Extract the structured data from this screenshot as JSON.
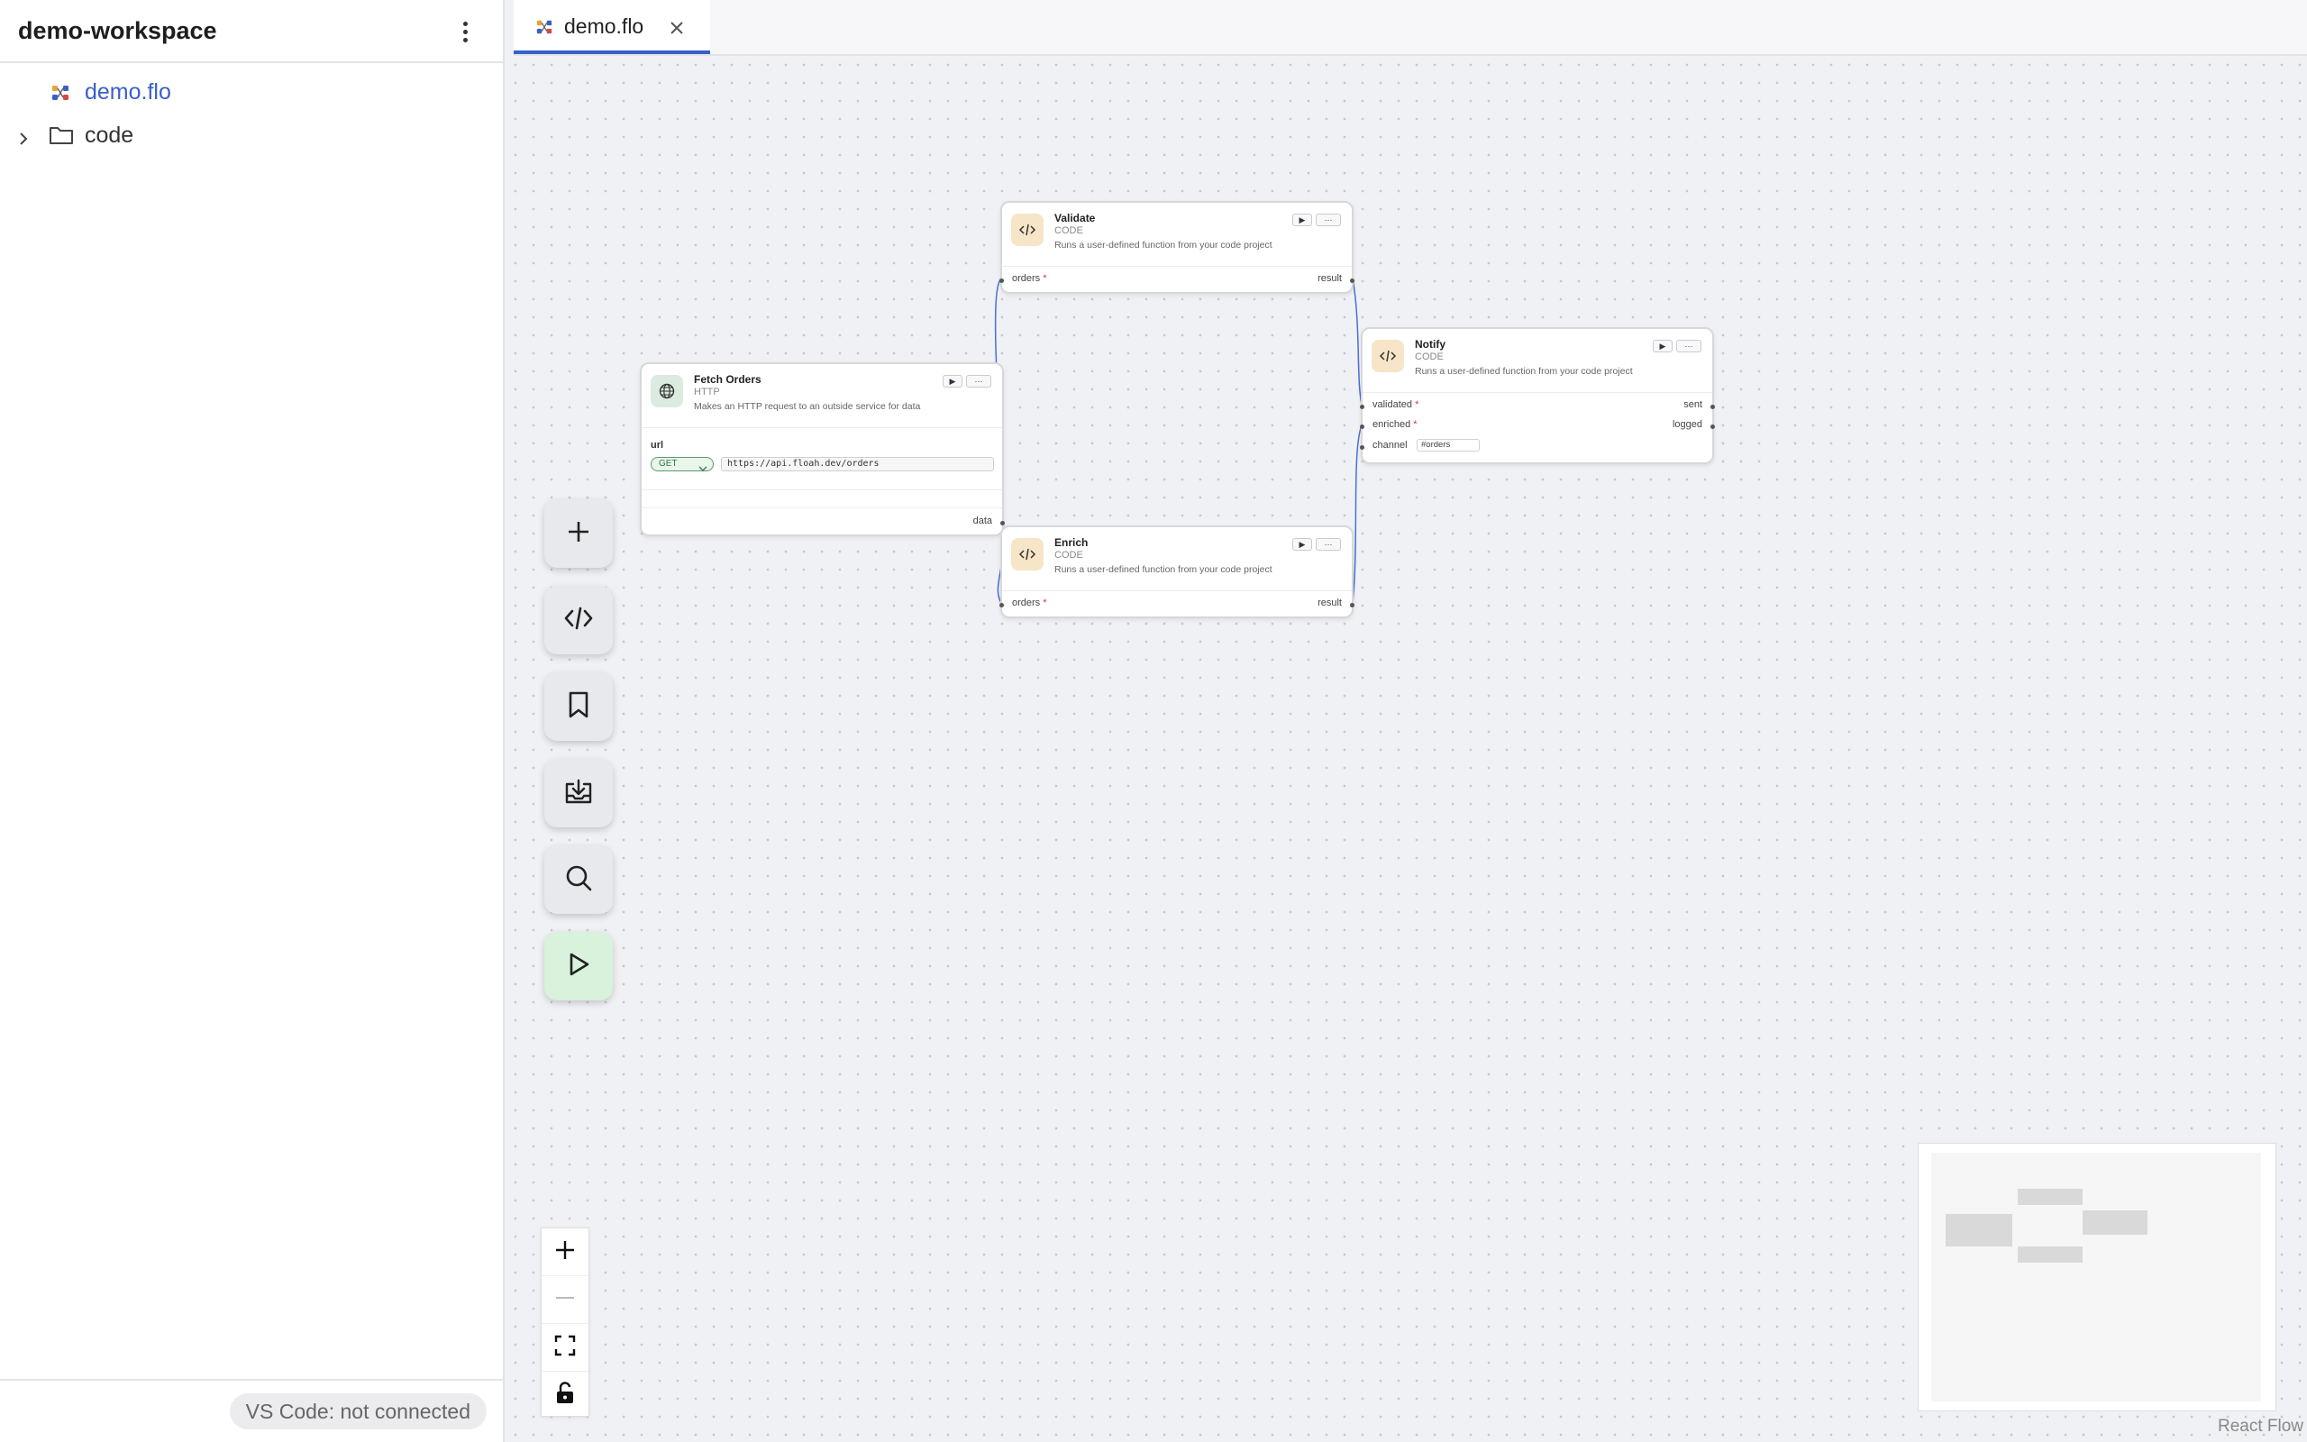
{
  "sidebar": {
    "title": "demo-workspace",
    "items": [
      {
        "label": "demo.flo",
        "icon": "flow-icon",
        "active": true
      },
      {
        "label": "code",
        "icon": "folder-icon",
        "expandable": true
      }
    ],
    "status": "VS Code: not connected"
  },
  "tabs": [
    {
      "label": "demo.flo",
      "active": true
    }
  ],
  "nodes": {
    "fetch_orders": {
      "title": "Fetch Orders",
      "type": "HTTP",
      "description": "Makes an HTTP request to an outside service for data",
      "url_label": "url",
      "method": "GET",
      "url": "https://api.floah.dev/orders",
      "output": "data"
    },
    "validate": {
      "title": "Validate",
      "type": "CODE",
      "description": "Runs a user-defined function from your code project",
      "input": "orders",
      "output": "result"
    },
    "enrich": {
      "title": "Enrich",
      "type": "CODE",
      "description": "Runs a user-defined function from your code project",
      "input": "orders",
      "output": "result"
    },
    "notify": {
      "title": "Notify",
      "type": "CODE",
      "description": "Runs a user-defined function from your code project",
      "inputs": [
        "validated",
        "enriched",
        "channel"
      ],
      "outputs": [
        "sent",
        "logged"
      ],
      "channel_value": "#orders"
    }
  },
  "node_buttons": {
    "run": "▶",
    "more": "···"
  },
  "required_mark": "*",
  "toolbar": [
    "add-icon",
    "code-icon",
    "bookmark-icon",
    "import-icon",
    "search-icon",
    "run-icon"
  ],
  "zoom_controls": [
    "zoom-in-icon",
    "zoom-out-icon",
    "fit-view-icon",
    "lock-icon"
  ],
  "attribution": "React Flow",
  "colors": {
    "accent": "#3a5fc9",
    "edge": "#4a6fd6",
    "run_button": "#d8f2dc",
    "code_icon_bg": "#f7e5c8",
    "http_icon_bg": "#dcebe0"
  }
}
